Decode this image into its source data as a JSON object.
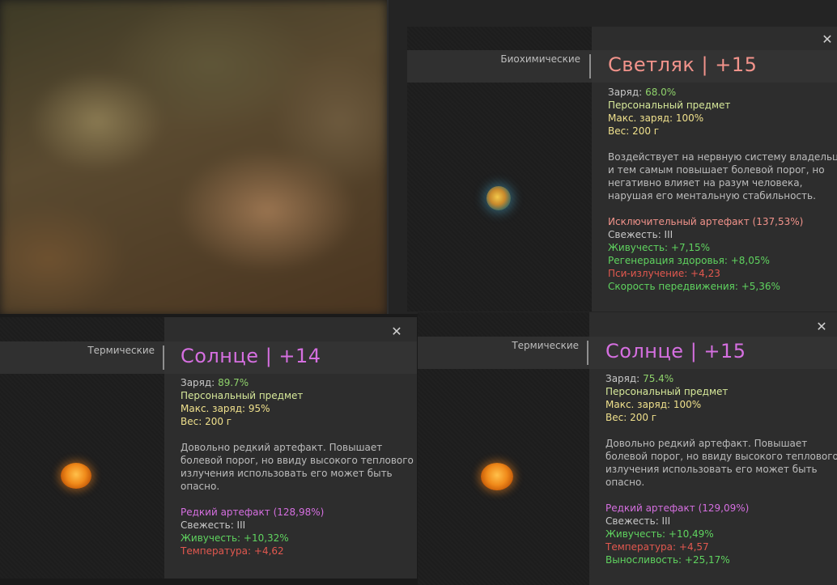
{
  "cards": [
    {
      "id": "svetlyak",
      "category": "Биохимические",
      "title": "Светляк | +15",
      "title_color": "#f2938b",
      "charge_label": "Заряд:",
      "charge_value": "68.0%",
      "personal": "Персональный предмет",
      "max_charge": "Макс. заряд: 100%",
      "weight": "Вес: 200 г",
      "description": [
        "Воздействует на нервную систему владельца",
        "и тем самым повышает болевой порог, но",
        "негативно влияет на разум человека,",
        "нарушая его ментальную стабильность."
      ],
      "rarity": "Исключительный артефакт (137,53%)",
      "freshness": "Свежесть: III",
      "stats": [
        {
          "text": "Живучесть: +7,15%",
          "kind": "good"
        },
        {
          "text": "Регенерация здоровья: +8,05%",
          "kind": "good"
        },
        {
          "text": "Пси-излучение: +4,23",
          "kind": "bad"
        },
        {
          "text": "Скорость передвижения: +5,36%",
          "kind": "good"
        }
      ]
    },
    {
      "id": "solntse14",
      "category": "Термические",
      "title": "Солнце | +14",
      "title_color": "#d56fe0",
      "charge_label": "Заряд:",
      "charge_value": "89.7%",
      "personal": "Персональный предмет",
      "max_charge": "Макс. заряд: 95%",
      "weight": "Вес: 200 г",
      "description": [
        "Довольно редкий артефакт. Повышает",
        "болевой порог, но ввиду высокого теплового",
        "излучения использовать его может быть",
        "опасно."
      ],
      "rarity": "Редкий артефакт (128,98%)",
      "freshness": "Свежесть: III",
      "stats": [
        {
          "text": "Живучесть: +10,32%",
          "kind": "good"
        },
        {
          "text": "Температура: +4,62",
          "kind": "bad"
        }
      ]
    },
    {
      "id": "solntse15",
      "category": "Термические",
      "title": "Солнце | +15",
      "title_color": "#d56fe0",
      "charge_label": "Заряд:",
      "charge_value": "75.4%",
      "personal": "Персональный предмет",
      "max_charge": "Макс. заряд: 100%",
      "weight": "Вес: 200 г",
      "description": [
        "Довольно редкий артефакт. Повышает",
        "болевой порог, но ввиду высокого теплового",
        "излучения использовать его может быть",
        "опасно."
      ],
      "rarity": "Редкий артефакт (129,09%)",
      "freshness": "Свежесть: III",
      "stats": [
        {
          "text": "Живучесть: +10,49%",
          "kind": "good"
        },
        {
          "text": "Температура: +4,57",
          "kind": "bad"
        },
        {
          "text": "Выносливость: +25,17%",
          "kind": "good"
        }
      ]
    }
  ],
  "close_icon": "close-icon",
  "colors": {
    "good": "#5fd35f",
    "bad": "#e2584f",
    "exceptional": "#f2938b",
    "rare": "#d56fe0"
  }
}
